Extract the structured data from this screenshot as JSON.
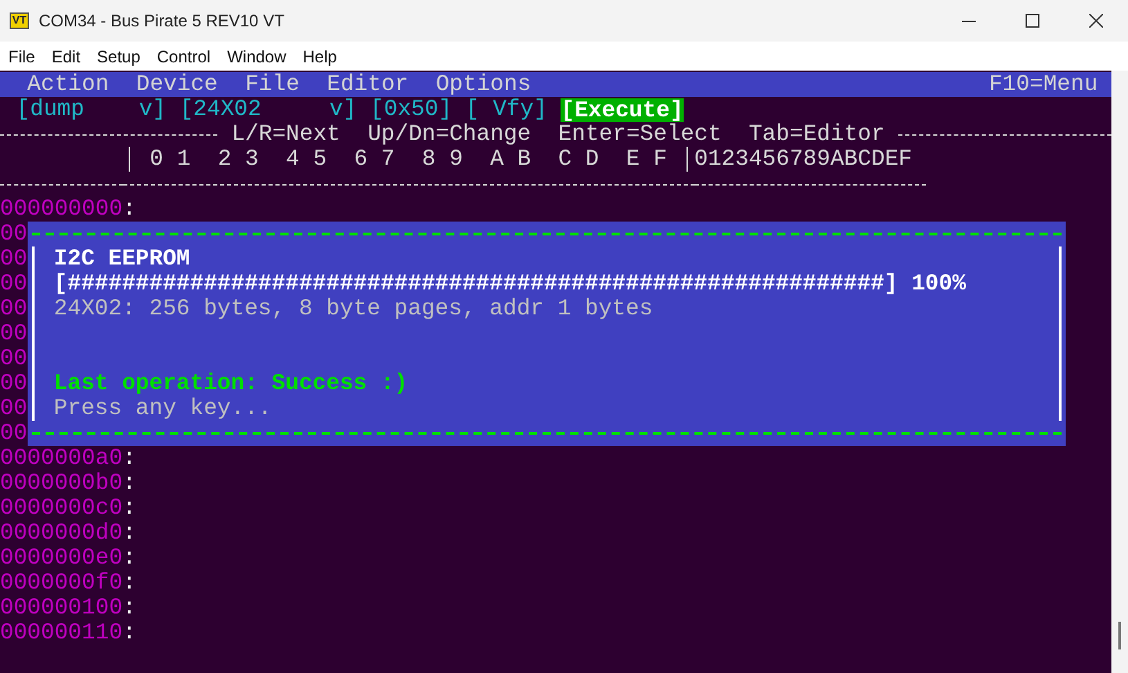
{
  "window": {
    "icon_text": "VT",
    "title": "COM34 - Bus Pirate 5 REV10 VT"
  },
  "menu": [
    "File",
    "Edit",
    "Setup",
    "Control",
    "Window",
    "Help"
  ],
  "terminal": {
    "menu_bar": {
      "items": [
        "Action",
        "Device",
        "File",
        "Editor",
        "Options"
      ],
      "shortcut": "F10=Menu"
    },
    "controls": [
      {
        "kind": "dropdown",
        "label": "[dump    v]"
      },
      {
        "kind": "dropdown",
        "label": "[24X02     v]"
      },
      {
        "kind": "dropdown",
        "label": "[0x50]"
      },
      {
        "kind": "dropdown",
        "label": "[ Vfy]"
      },
      {
        "kind": "action",
        "label": "[Execute]"
      }
    ],
    "hint": "L/R=Next  Up/Dn=Change  Enter=Select  Tab=Editor",
    "hex_header": "0 1  2 3  4 5  6 7  8 9  A B  C D  E F",
    "ascii_header": "0123456789ABCDEF",
    "rows_before": [
      "000000000:"
    ],
    "covered_addresses": [
      "00",
      "00",
      "00",
      "00",
      "00",
      "00",
      "00",
      "00",
      "00"
    ],
    "dialog": {
      "title": "I2C EEPROM",
      "progress": {
        "bar": "[############################################################]",
        "reading": "100%"
      },
      "info": "24X02: 256 bytes, 8 byte pages, addr 1 bytes",
      "status": "Last operation: Success :)",
      "prompt": "Press any key..."
    },
    "rows_after": [
      "0000000a0:",
      "0000000b0:",
      "0000000c0:",
      "0000000d0:",
      "0000000e0:",
      "0000000f0:",
      "000000100:",
      "000000110:"
    ]
  }
}
